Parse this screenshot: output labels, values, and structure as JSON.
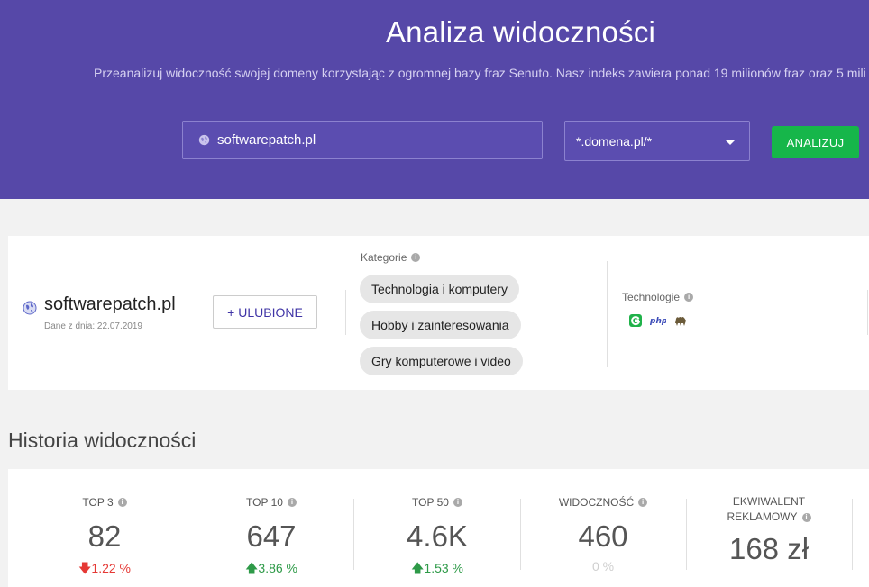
{
  "header": {
    "title": "Analiza widoczności",
    "subtitle": "Przeanalizuj widoczność swojej domeny korzystając z ogromnej bazy fraz Senuto. Nasz indeks zawiera ponad 19 milionów fraz oraz 5 mili",
    "domain_input_value": "softwarepatch.pl",
    "scope_select_value": "*.domena.pl/*",
    "analyze_label": "ANALIZUJ",
    "colors": {
      "background": "#5648a8",
      "button": "#16b64a"
    }
  },
  "domain_card": {
    "name": "softwarepatch.pl",
    "date": "Dane z dnia: 22.07.2019",
    "favorite_label": "+ ULUBIONE",
    "categories_label": "Kategorie",
    "categories": [
      "Technologia i komputery",
      "Hobby i zainteresowania",
      "Gry komputerowe i video"
    ],
    "technologies_label": "Technologie",
    "technologies": [
      "google-g-icon",
      "php-icon",
      "camel-icon"
    ]
  },
  "history": {
    "title": "Historia widoczności",
    "stats": [
      {
        "label": "TOP 3",
        "value": "82",
        "change": "1.22 %",
        "direction": "down"
      },
      {
        "label": "TOP 10",
        "value": "647",
        "change": "3.86 %",
        "direction": "up"
      },
      {
        "label": "TOP 50",
        "value": "4.6K",
        "change": "1.53 %",
        "direction": "up"
      },
      {
        "label": "WIDOCZNOŚĆ",
        "value": "460",
        "change": "0 %",
        "direction": "neutral"
      },
      {
        "label_line1": "EKWIWALENT",
        "label_line2": "REKLAMOWY",
        "value": "168 zł"
      }
    ]
  }
}
